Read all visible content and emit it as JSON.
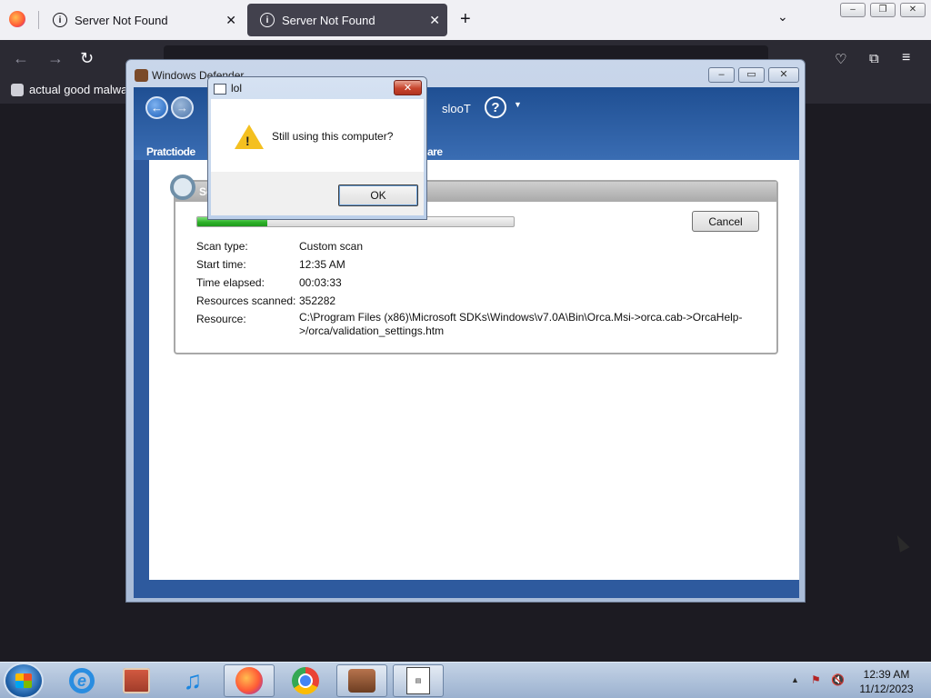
{
  "browser": {
    "tabs": [
      {
        "title": "Server Not Found",
        "active": false
      },
      {
        "title": "Server Not Found",
        "active": true
      }
    ],
    "bookmark": "actual good malwar"
  },
  "defender": {
    "window_title": "Windows Defender",
    "tools_label": "slooT",
    "status_text": "Pratctiode",
    "status_text2": "are",
    "scan_header": "Sc",
    "cancel_label": "Cancel",
    "progress_fraction": 0.22,
    "scan_type_label": "Scan type:",
    "scan_type_value": "Custom scan",
    "start_time_label": "Start time:",
    "start_time_value": "12:35 AM",
    "time_elapsed_label": "Time elapsed:",
    "time_elapsed_value": "00:03:33",
    "resources_scanned_label": "Resources scanned:",
    "resources_scanned_value": "352282",
    "resource_label": "Resource:",
    "resource_value": "C:\\Program Files (x86)\\Microsoft SDKs\\Windows\\v7.0A\\Bin\\Orca.Msi->orca.cab->OrcaHelp->/orca/validation_settings.htm"
  },
  "dialog": {
    "title": "lol",
    "message": "Still using this computer?",
    "ok_label": "OK"
  },
  "taskbar": {
    "time": "12:39 AM",
    "date": "11/12/2023"
  }
}
